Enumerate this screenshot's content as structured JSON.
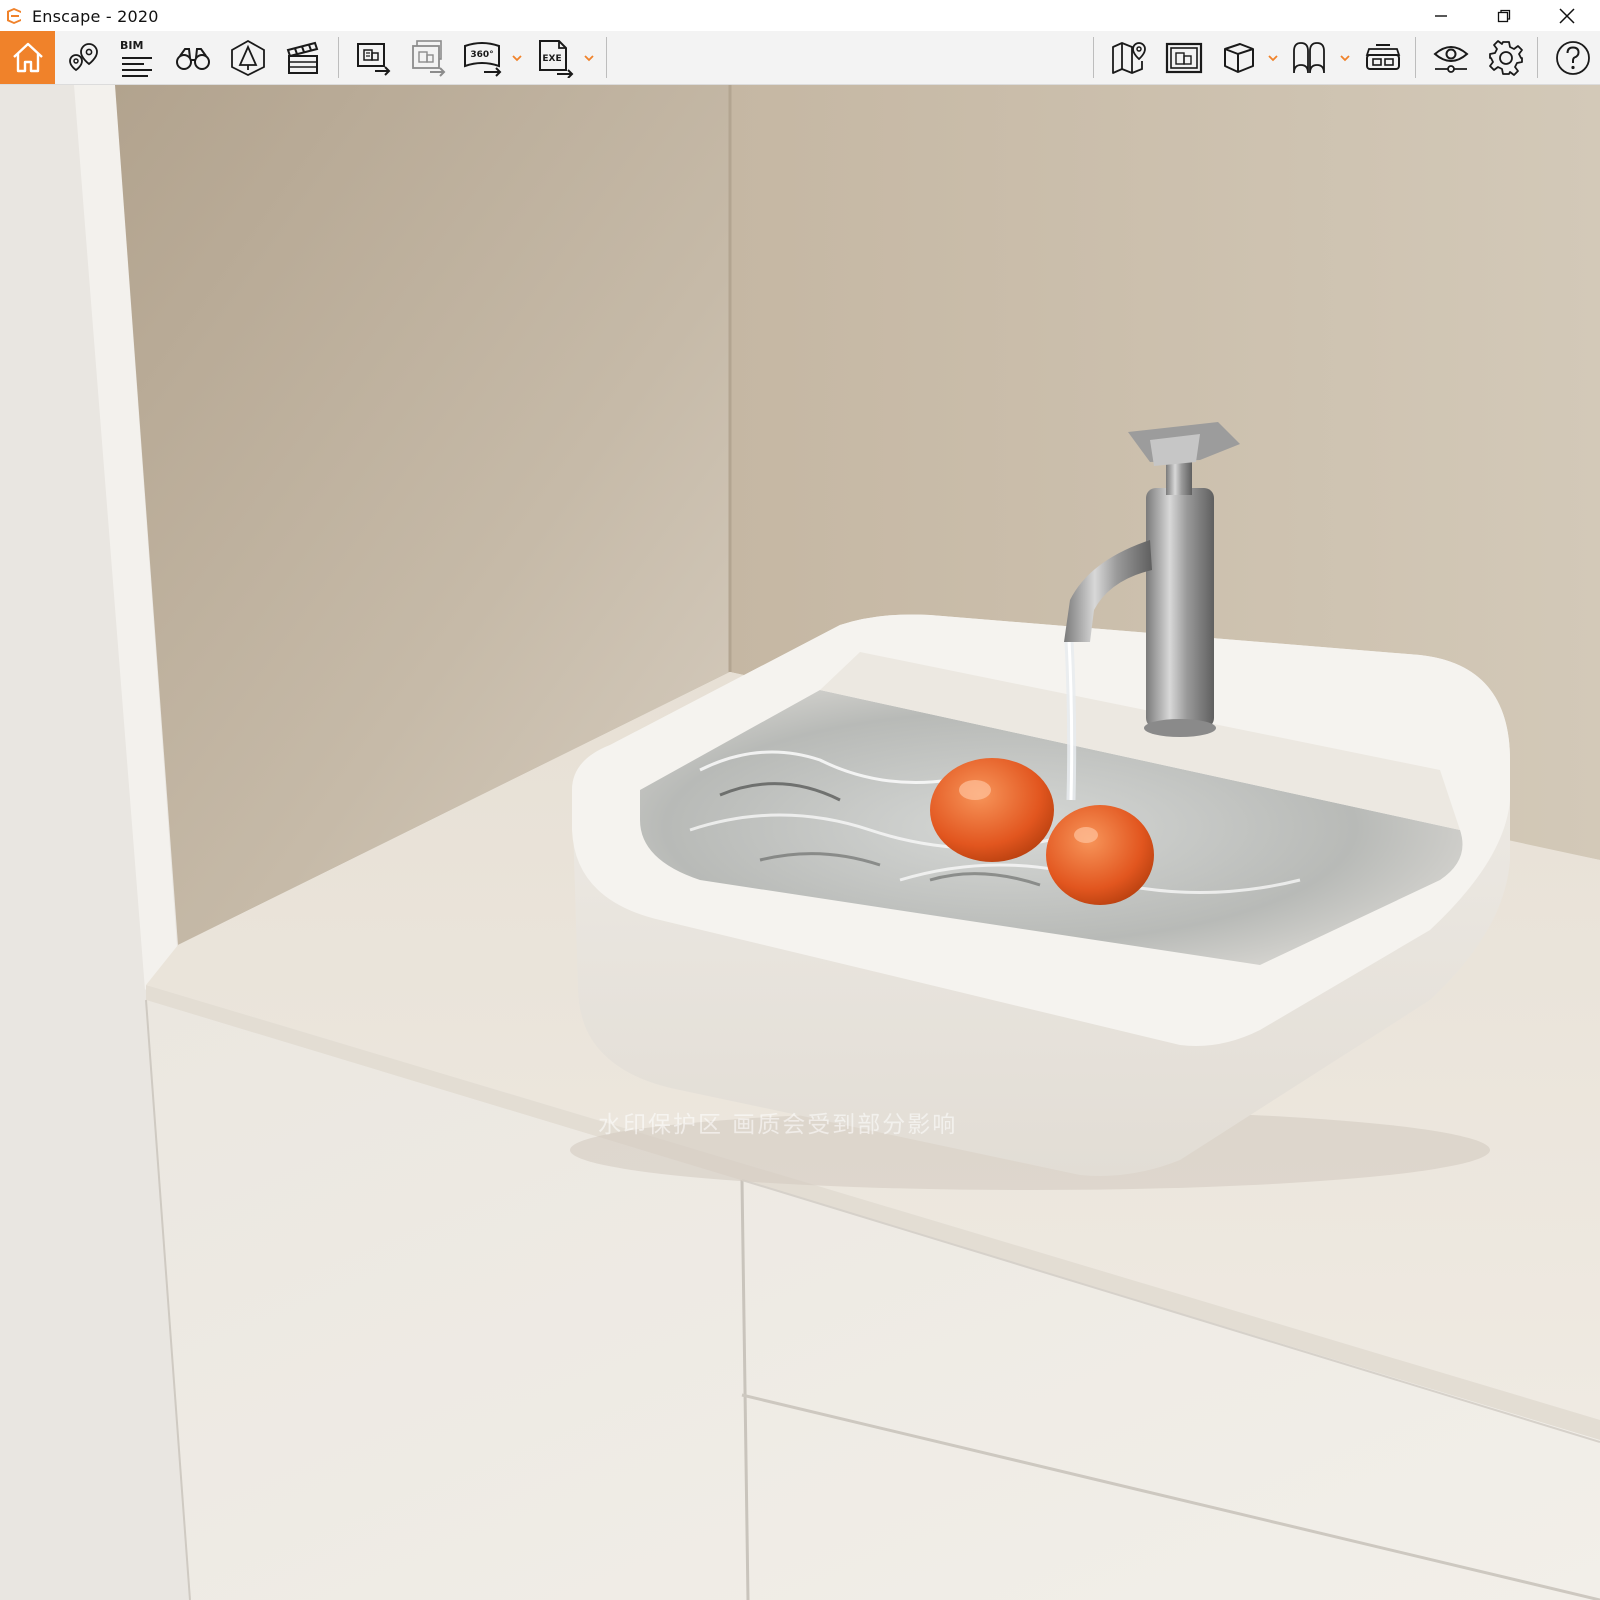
{
  "window": {
    "title": "Enscape - 2020"
  },
  "toolbar": {
    "bim_label": "BIM",
    "icon_360": "360°",
    "icon_exe": "EXE"
  },
  "viewport": {
    "watermark": "水印保护区   画质会受到部分影响"
  },
  "colors": {
    "accent": "#f0822a",
    "toolbar_bg": "#f3f3f3",
    "icon": "#1a1a1a"
  }
}
